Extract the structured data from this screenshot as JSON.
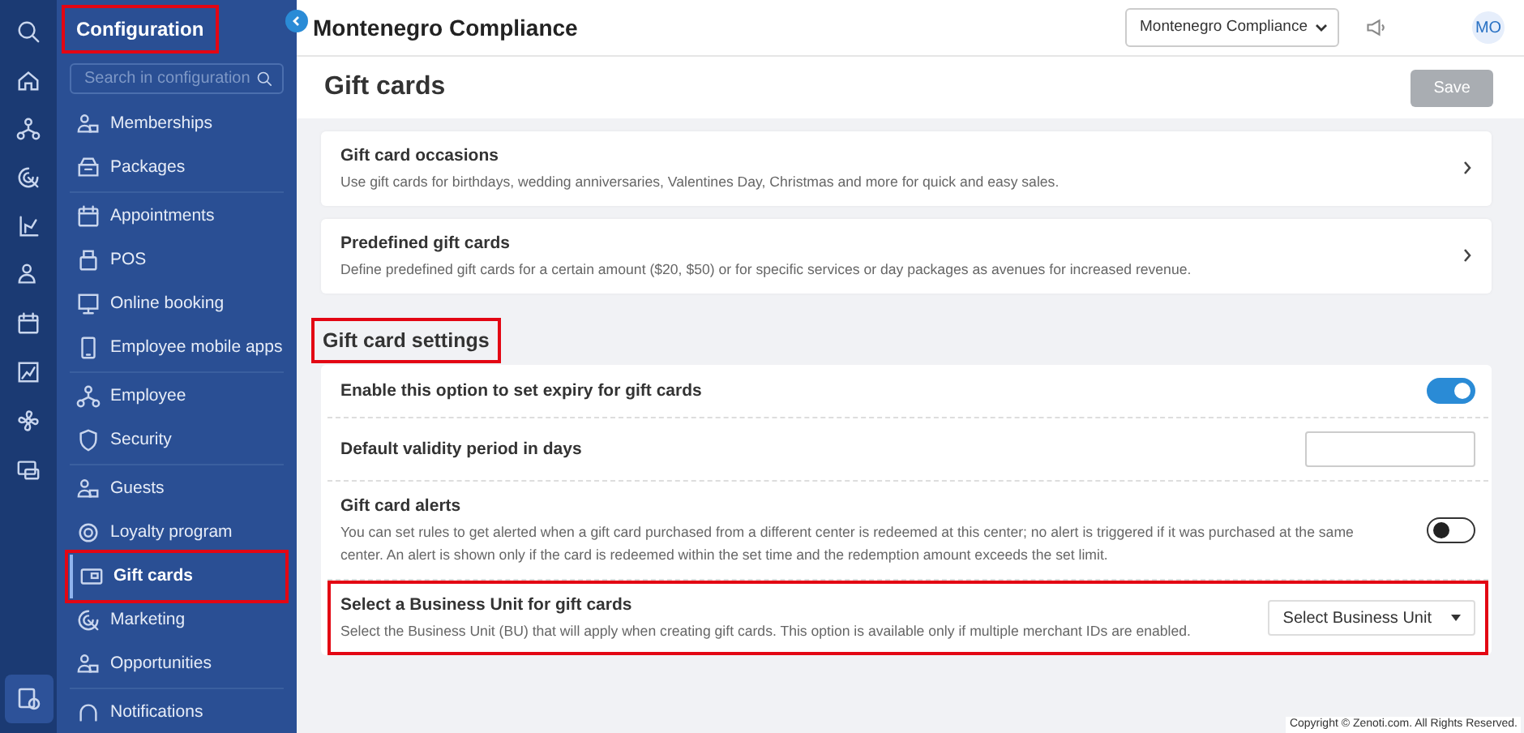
{
  "rail": {
    "items": [
      {
        "kind": "search",
        "selected": false
      },
      {
        "kind": "home",
        "selected": false
      },
      {
        "kind": "org",
        "selected": false
      },
      {
        "kind": "target",
        "selected": false
      },
      {
        "kind": "chart",
        "selected": false
      },
      {
        "kind": "person",
        "selected": false
      },
      {
        "kind": "calendar",
        "selected": false
      },
      {
        "kind": "report",
        "selected": false
      },
      {
        "kind": "fan",
        "selected": false
      },
      {
        "kind": "money",
        "selected": false
      }
    ],
    "settings_selected": true
  },
  "sidebar": {
    "title": "Configuration",
    "title_highlighted": true,
    "search": {
      "placeholder": "Search in configuration"
    },
    "groups": [
      [
        {
          "label": "Memberships",
          "selected": false,
          "highlighted": false
        },
        {
          "label": "Packages",
          "selected": false,
          "highlighted": false
        }
      ],
      [
        {
          "label": "Appointments",
          "selected": false,
          "highlighted": false
        },
        {
          "label": "POS",
          "selected": false,
          "highlighted": false
        },
        {
          "label": "Online booking",
          "selected": false,
          "highlighted": false
        },
        {
          "label": "Employee mobile apps",
          "selected": false,
          "highlighted": false
        }
      ],
      [
        {
          "label": "Employee",
          "selected": false,
          "highlighted": false
        },
        {
          "label": "Security",
          "selected": false,
          "highlighted": false
        }
      ],
      [
        {
          "label": "Guests",
          "selected": false,
          "highlighted": false
        },
        {
          "label": "Loyalty program",
          "selected": false,
          "highlighted": false
        },
        {
          "label": "Gift cards",
          "selected": true,
          "highlighted": true
        },
        {
          "label": "Marketing",
          "selected": false,
          "highlighted": false
        },
        {
          "label": "Opportunities",
          "selected": false,
          "highlighted": false
        }
      ],
      [
        {
          "label": "Notifications",
          "selected": false,
          "highlighted": false
        }
      ]
    ]
  },
  "header": {
    "org_name": "Montenegro Compliance",
    "org_select": "Montenegro Compliance",
    "avatar": "MO"
  },
  "page": {
    "title": "Gift cards",
    "save_button": {
      "label": "Save",
      "disabled": true
    }
  },
  "link_cards": [
    {
      "title": "Gift card occasions",
      "description": "Use gift cards for birthdays, wedding anniversaries, Valentines Day, Christmas and more for quick and easy sales."
    },
    {
      "title": "Predefined gift cards",
      "description": "Define predefined gift cards for a certain amount ($20, $50) or for specific services or day packages as avenues for increased revenue."
    }
  ],
  "settings": {
    "heading": "Gift card settings",
    "heading_highlighted": true,
    "rows": [
      {
        "kind": "toggle",
        "title": "Enable this option to set expiry for gift cards",
        "on": true,
        "highlighted": false
      },
      {
        "kind": "input",
        "title": "Default validity period in days",
        "highlighted": false
      },
      {
        "kind": "toggle",
        "title": "Gift card alerts",
        "description": "You can set rules to get alerted when a gift card purchased from a different center is redeemed at this center; no alert is triggered if it was purchased at the same center. An alert is shown only if the card is redeemed within the set time and the redemption amount exceeds the set limit.",
        "on": false,
        "highlighted": false
      },
      {
        "kind": "select",
        "title": "Select a Business Unit for gift cards",
        "description": "Select the Business Unit (BU) that will apply when creating gift cards. This option is available only if multiple merchant IDs are enabled.",
        "value": "Select Business Unit",
        "highlighted": true
      }
    ]
  },
  "footer": {
    "copyright": "Copyright © Zenoti.com. All Rights Reserved."
  }
}
